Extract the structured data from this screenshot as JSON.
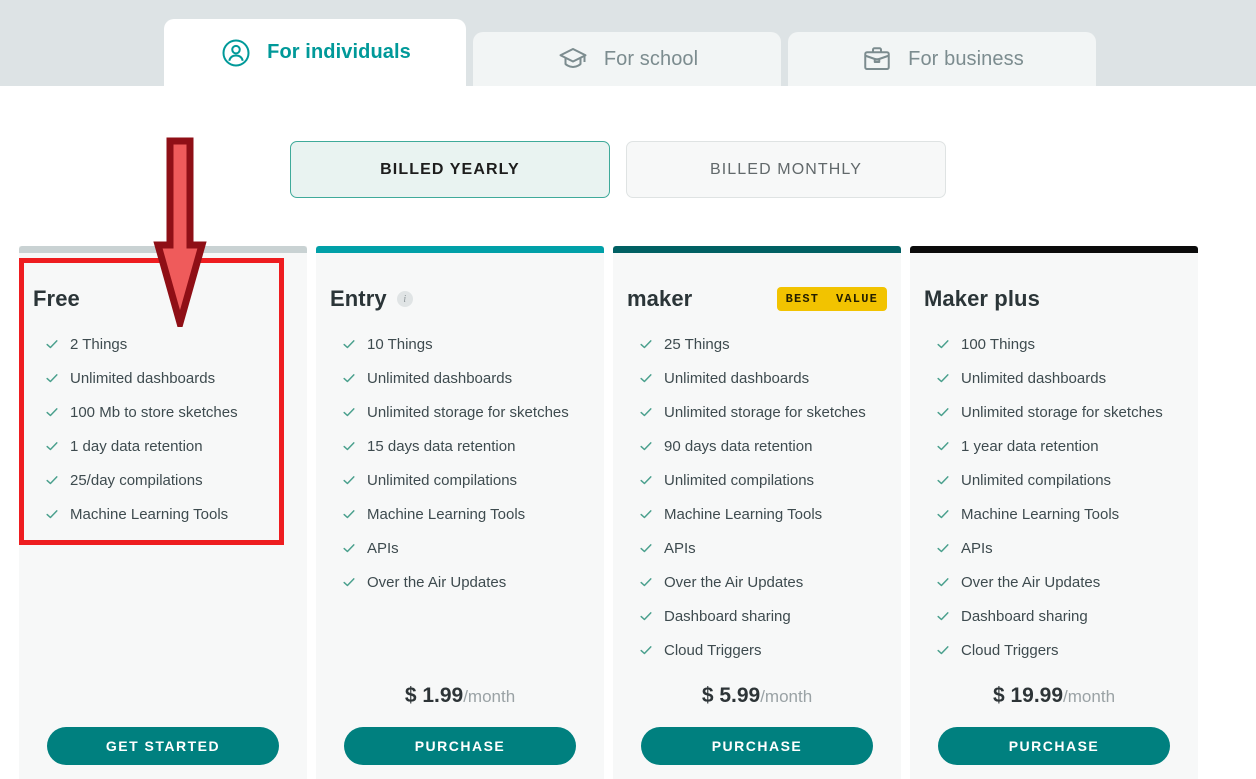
{
  "audience_tabs": [
    {
      "id": "individuals",
      "label": "For individuals",
      "icon": "user-circle-icon",
      "active": true
    },
    {
      "id": "school",
      "label": "For school",
      "icon": "graduation-cap-icon",
      "active": false
    },
    {
      "id": "business",
      "label": "For business",
      "icon": "briefcase-icon",
      "active": false
    }
  ],
  "billing_toggle": {
    "options": [
      {
        "id": "yearly",
        "label": "BILLED YEARLY",
        "selected": true
      },
      {
        "id": "monthly",
        "label": "BILLED MONTHLY",
        "selected": false
      }
    ]
  },
  "plans": [
    {
      "id": "free",
      "name": "Free",
      "top_bar_color": "#c9d2d3",
      "badge": null,
      "info_icon": null,
      "features": [
        "2 Things",
        "Unlimited dashboards",
        "100 Mb to store sketches",
        "1 day data retention",
        "25/day compilations",
        "Machine Learning Tools"
      ],
      "price_amount": null,
      "price_period": null,
      "cta_label": "GET STARTED"
    },
    {
      "id": "entry",
      "name": "Entry",
      "top_bar_color": "#00a0a8",
      "badge": null,
      "info_icon": "info-icon",
      "features": [
        "10 Things",
        "Unlimited dashboards",
        "Unlimited storage for sketches",
        "15 days data retention",
        "Unlimited compilations",
        "Machine Learning Tools",
        "APIs",
        "Over the Air Updates"
      ],
      "price_amount": "$ 1.99",
      "price_period": "/month",
      "cta_label": "PURCHASE"
    },
    {
      "id": "maker",
      "name": "maker",
      "top_bar_color": "#006063",
      "badge": "BEST  VALUE",
      "info_icon": null,
      "features": [
        "25 Things",
        "Unlimited dashboards",
        "Unlimited storage for sketches",
        "90 days data retention",
        "Unlimited compilations",
        "Machine Learning Tools",
        "APIs",
        "Over the Air Updates",
        "Dashboard sharing",
        "Cloud Triggers"
      ],
      "price_amount": "$ 5.99",
      "price_period": "/month",
      "cta_label": "PURCHASE"
    },
    {
      "id": "maker_plus",
      "name": "Maker plus",
      "top_bar_color": "#0b0b0b",
      "badge": null,
      "info_icon": null,
      "features": [
        "100 Things",
        "Unlimited dashboards",
        "Unlimited storage for sketches",
        "1 year data retention",
        "Unlimited compilations",
        "Machine Learning Tools",
        "APIs",
        "Over the Air Updates",
        "Dashboard sharing",
        "Cloud Triggers"
      ],
      "price_amount": "$ 19.99",
      "price_period": "/month",
      "cta_label": "PURCHASE"
    }
  ],
  "annotation": {
    "highlight_color": "#ee1d20",
    "arrow_color": "#ef5b5b",
    "arrow_outline_color": "#8f0f16",
    "target_plan": "free"
  },
  "colors": {
    "accent_teal": "#009999",
    "cta_teal": "#00807f",
    "header_band": "#dde3e5",
    "card_bg": "#f7f8f8",
    "check_green": "#4aa08d"
  }
}
